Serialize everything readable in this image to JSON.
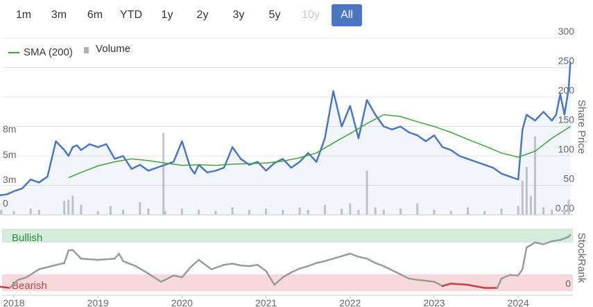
{
  "range_selector": {
    "buttons": [
      {
        "label": "1m",
        "state": "normal"
      },
      {
        "label": "3m",
        "state": "normal"
      },
      {
        "label": "6m",
        "state": "normal"
      },
      {
        "label": "YTD",
        "state": "normal"
      },
      {
        "label": "1y",
        "state": "normal"
      },
      {
        "label": "2y",
        "state": "normal"
      },
      {
        "label": "3y",
        "state": "normal"
      },
      {
        "label": "5y",
        "state": "normal"
      },
      {
        "label": "10y",
        "state": "disabled"
      },
      {
        "label": "All",
        "state": "active"
      }
    ]
  },
  "chart_data": {
    "type": "line",
    "legend": [
      {
        "name": "SMA (200)",
        "color": "#3fa23f",
        "marker": "line"
      },
      {
        "name": "Volume",
        "color": "#b0b0b8",
        "marker": "square"
      }
    ],
    "price_axis": {
      "label": "Share Price",
      "ticks": [
        "300",
        "250",
        "200",
        "150",
        "100",
        "50",
        "0.00"
      ],
      "range": [
        0,
        300
      ]
    },
    "volume_axis": {
      "ticks": [
        "8m",
        "5m",
        "3m",
        "0"
      ]
    },
    "stockrank_axis": {
      "label": "StockRank",
      "ticks": [
        "0"
      ]
    },
    "stockrank_bands": {
      "upper": "Bullish",
      "lower": "Bearish"
    },
    "x_axis": {
      "ticks": [
        "2018",
        "2019",
        "2020",
        "2021",
        "2022",
        "2023",
        "2024"
      ]
    },
    "colors": {
      "price": "#4a77bf",
      "sma": "#3fa23f",
      "volume": "#c8c8cc",
      "bullish_band": "#d3ecdc",
      "bearish_band": "#f7d9db",
      "bullish_text": "#2e8b3e",
      "bearish_text": "#c0444c",
      "rank_normal": "#9a9a9a",
      "rank_bearish": "#c83a44"
    },
    "series": [
      {
        "name": "Price",
        "x": [
          2017.83,
          2017.92,
          2018.0,
          2018.1,
          2018.2,
          2018.3,
          2018.4,
          2018.5,
          2018.6,
          2018.65,
          2018.7,
          2018.75,
          2018.8,
          2018.9,
          2019.0,
          2019.1,
          2019.2,
          2019.3,
          2019.4,
          2019.5,
          2019.6,
          2019.7,
          2019.8,
          2019.9,
          2020.0,
          2020.1,
          2020.15,
          2020.2,
          2020.3,
          2020.4,
          2020.5,
          2020.6,
          2020.7,
          2020.8,
          2020.9,
          2021.0,
          2021.1,
          2021.2,
          2021.3,
          2021.4,
          2021.5,
          2021.6,
          2021.7,
          2021.75,
          2021.8,
          2021.9,
          2022.0,
          2022.1,
          2022.2,
          2022.3,
          2022.4,
          2022.5,
          2022.6,
          2022.7,
          2022.8,
          2022.9,
          2023.0,
          2023.1,
          2023.2,
          2023.3,
          2023.4,
          2023.5,
          2023.6,
          2023.7,
          2023.8,
          2023.9,
          2024.0,
          2024.05,
          2024.1,
          2024.2,
          2024.3,
          2024.4,
          2024.45,
          2024.5,
          2024.55,
          2024.6,
          2024.62
        ],
        "values": [
          33,
          35,
          40,
          45,
          60,
          55,
          65,
          125,
          110,
          100,
          115,
          118,
          110,
          120,
          115,
          120,
          95,
          100,
          78,
          85,
          75,
          80,
          85,
          90,
          125,
          80,
          70,
          85,
          72,
          75,
          80,
          115,
          95,
          85,
          90,
          75,
          88,
          95,
          80,
          90,
          105,
          90,
          130,
          170,
          210,
          150,
          185,
          130,
          195,
          170,
          150,
          145,
          150,
          140,
          135,
          125,
          135,
          115,
          110,
          100,
          95,
          90,
          85,
          80,
          70,
          65,
          60,
          145,
          170,
          160,
          175,
          160,
          170,
          205,
          170,
          215,
          260
        ]
      },
      {
        "name": "SMA (200)",
        "x": [
          2018.65,
          2018.8,
          2019.0,
          2019.2,
          2019.4,
          2019.6,
          2019.8,
          2020.0,
          2020.2,
          2020.4,
          2020.6,
          2020.8,
          2021.0,
          2021.2,
          2021.4,
          2021.6,
          2021.8,
          2022.0,
          2022.2,
          2022.4,
          2022.6,
          2022.8,
          2023.0,
          2023.2,
          2023.4,
          2023.6,
          2023.8,
          2024.0,
          2024.2,
          2024.4,
          2024.62
        ],
        "values": [
          63,
          72,
          83,
          90,
          95,
          92,
          88,
          84,
          85,
          84,
          86,
          87,
          88,
          91,
          97,
          105,
          122,
          138,
          155,
          170,
          167,
          158,
          150,
          140,
          128,
          117,
          105,
          98,
          108,
          130,
          150
        ]
      },
      {
        "name": "Volume",
        "x": [
          2017.85,
          2018.0,
          2018.2,
          2018.3,
          2018.6,
          2018.65,
          2018.7,
          2018.8,
          2019.0,
          2019.15,
          2019.3,
          2019.5,
          2019.6,
          2019.78,
          2019.8,
          2020.0,
          2020.2,
          2020.4,
          2020.6,
          2020.8,
          2021.0,
          2021.2,
          2021.4,
          2021.5,
          2021.7,
          2021.9,
          2022.0,
          2022.1,
          2022.2,
          2022.3,
          2022.4,
          2022.6,
          2022.8,
          2023.0,
          2023.2,
          2023.4,
          2023.6,
          2023.8,
          2024.0,
          2024.05,
          2024.1,
          2024.15,
          2024.2,
          2024.3,
          2024.4,
          2024.55,
          2024.6
        ],
        "values": [
          0.4,
          0.3,
          0.5,
          0.4,
          1.1,
          1.2,
          1.5,
          0.8,
          0.3,
          0.7,
          0.4,
          1.0,
          0.5,
          6.5,
          0.3,
          0.5,
          0.4,
          0.3,
          0.6,
          0.4,
          0.5,
          0.4,
          0.6,
          0.4,
          0.8,
          0.5,
          0.9,
          0.4,
          3.5,
          0.6,
          0.4,
          0.5,
          0.9,
          0.4,
          0.3,
          0.6,
          0.3,
          0.5,
          0.7,
          2.7,
          3.8,
          1.5,
          6.2,
          0.6,
          0.4,
          0.5,
          1.2
        ]
      },
      {
        "name": "StockRank",
        "x": [
          2017.83,
          2017.95,
          2018.05,
          2018.15,
          2018.3,
          2018.45,
          2018.6,
          2018.65,
          2018.7,
          2018.8,
          2019.0,
          2019.2,
          2019.25,
          2019.3,
          2019.45,
          2019.6,
          2019.75,
          2019.8,
          2019.9,
          2020.0,
          2020.1,
          2020.2,
          2020.35,
          2020.5,
          2020.6,
          2020.7,
          2020.8,
          2020.9,
          2021.0,
          2021.1,
          2021.2,
          2021.3,
          2021.4,
          2021.5,
          2021.6,
          2021.7,
          2021.8,
          2022.0,
          2022.1,
          2022.2,
          2022.3,
          2022.4,
          2022.55,
          2022.7,
          2022.8,
          2023.0,
          2023.1,
          2023.2,
          2023.4,
          2023.6,
          2023.75,
          2023.8,
          2023.9,
          2024.0,
          2024.05,
          2024.1,
          2024.2,
          2024.3,
          2024.4,
          2024.5,
          2024.6,
          2024.62
        ],
        "values": [
          7,
          5,
          18,
          22,
          35,
          40,
          45,
          65,
          66,
          52,
          50,
          52,
          60,
          48,
          40,
          28,
          15,
          18,
          25,
          22,
          38,
          50,
          35,
          42,
          44,
          41,
          40,
          42,
          32,
          10,
          22,
          30,
          36,
          40,
          45,
          48,
          52,
          60,
          55,
          52,
          45,
          40,
          30,
          20,
          18,
          15,
          8,
          12,
          10,
          5,
          5,
          20,
          26,
          25,
          35,
          70,
          78,
          75,
          80,
          82,
          87,
          90
        ]
      }
    ]
  }
}
